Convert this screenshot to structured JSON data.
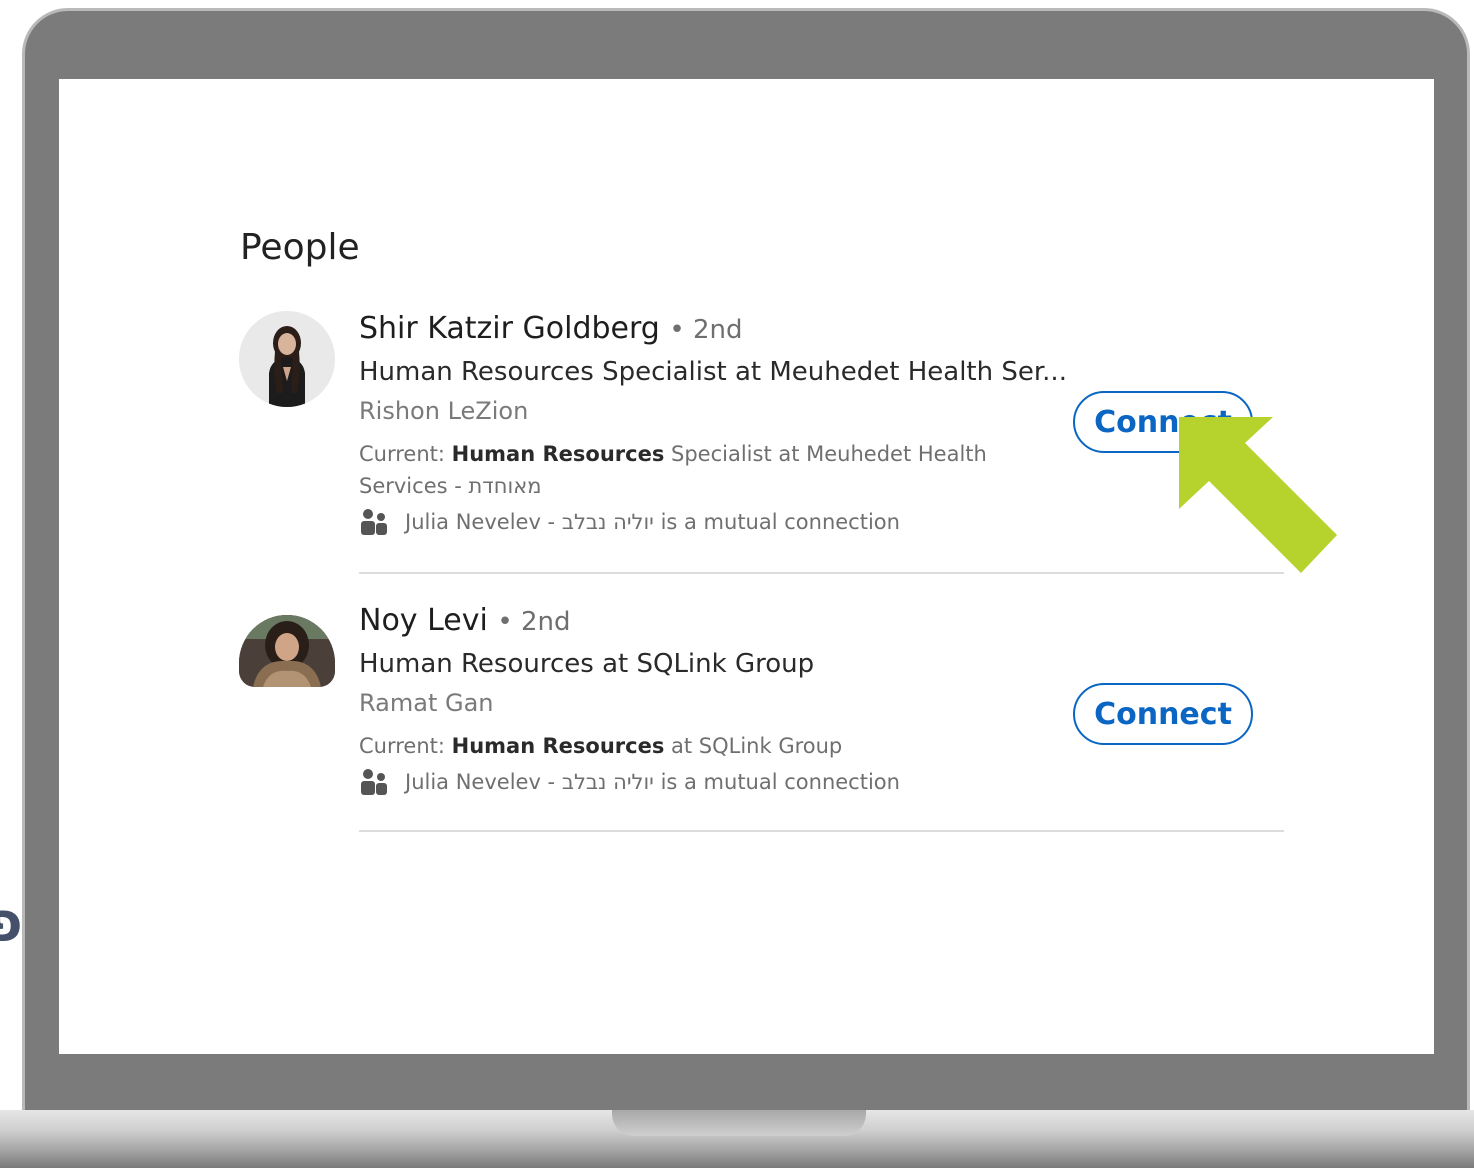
{
  "section": {
    "title": "People"
  },
  "people": [
    {
      "name": "Shir Katzir Goldberg",
      "degree": "• 2nd",
      "headline": "Human Resources Specialist at Meuhedet Health Ser...",
      "location": "Rishon LeZion",
      "current_label": "Current:",
      "current_bold": "Human Resources",
      "current_rest": "Specialist at Meuhedet Health Services - מאוחדת",
      "mutual_text": "Julia Nevelev - יוליה נבלב is a mutual connection",
      "connect_label": "Connect"
    },
    {
      "name": "Noy Levi",
      "degree": "• 2nd",
      "headline": "Human Resources at SQLink Group",
      "location": "Ramat Gan",
      "current_label": "Current:",
      "current_bold": "Human Resources",
      "current_rest": "at SQLink Group",
      "mutual_text": "Julia Nevelev - יוליה נבלב is a mutual connection",
      "connect_label": "Connect"
    }
  ],
  "edge_glyph": "פ",
  "colors": {
    "accent": "#0a66c2",
    "arrow": "#b6d22c",
    "laptop_body": "#7b7b7b"
  },
  "icons": {
    "mutual": "people-icon",
    "annotation": "arrow-icon"
  }
}
